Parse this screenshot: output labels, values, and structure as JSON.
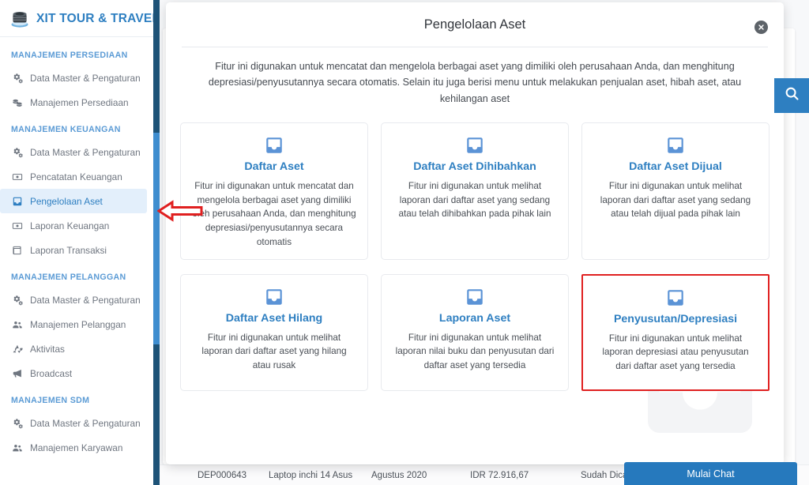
{
  "brand": {
    "name": "XIT TOUR & TRAVEL",
    "logo_icon": "layer-stack-logo",
    "color": "#2e7fc1"
  },
  "sidebar": {
    "groups": [
      {
        "title": "MANAJEMEN PERSEDIAAN",
        "items": [
          {
            "label": "Data Master & Pengaturan",
            "icon": "cogs-icon",
            "active": false
          },
          {
            "label": "Manajemen Persediaan",
            "icon": "coins-icon",
            "active": false
          }
        ]
      },
      {
        "title": "MANAJEMEN KEUANGAN",
        "items": [
          {
            "label": "Data Master & Pengaturan",
            "icon": "cogs-icon",
            "active": false
          },
          {
            "label": "Pencatatan Keuangan",
            "icon": "money-bill-icon",
            "active": false
          },
          {
            "label": "Pengelolaan Aset",
            "icon": "inbox-icon",
            "active": true
          },
          {
            "label": "Laporan Keuangan",
            "icon": "money-bill-icon",
            "active": false
          },
          {
            "label": "Laporan Transaksi",
            "icon": "book-icon",
            "active": false
          }
        ]
      },
      {
        "title": "MANAJEMEN PELANGGAN",
        "items": [
          {
            "label": "Data Master & Pengaturan",
            "icon": "cogs-icon",
            "active": false
          },
          {
            "label": "Manajemen Pelanggan",
            "icon": "users-icon",
            "active": false
          },
          {
            "label": "Aktivitas",
            "icon": "recycle-icon",
            "active": false
          },
          {
            "label": "Broadcast",
            "icon": "bullhorn-icon",
            "active": false
          }
        ]
      },
      {
        "title": "MANAJEMEN SDM",
        "items": [
          {
            "label": "Data Master & Pengaturan",
            "icon": "cogs-icon",
            "active": false
          },
          {
            "label": "Manajemen Karyawan",
            "icon": "users-icon",
            "active": false
          }
        ]
      }
    ]
  },
  "modal": {
    "title": "Pengelolaan Aset",
    "close_icon": "close-circle-icon",
    "description": "Fitur ini digunakan untuk mencatat dan mengelola berbagai aset yang dimiliki oleh perusahaan Anda, dan menghitung depresiasi/penyusutannya secara otomatis. Selain itu juga berisi menu untuk melakukan penjualan aset, hibah aset, atau kehilangan aset",
    "watermark_icon": "inbox-icon",
    "cards": [
      {
        "icon": "inbox-icon",
        "title": "Daftar Aset",
        "description": "Fitur ini digunakan untuk mencatat dan mengelola berbagai aset yang dimiliki oleh perusahaan Anda, dan menghitung depresiasi/penyusutannya secara otomatis",
        "highlighted": false
      },
      {
        "icon": "inbox-icon",
        "title": "Daftar Aset Dihibahkan",
        "description": "Fitur ini digunakan untuk melihat laporan dari daftar aset yang sedang atau telah dihibahkan pada pihak lain",
        "highlighted": false
      },
      {
        "icon": "inbox-icon",
        "title": "Daftar Aset Dijual",
        "description": "Fitur ini digunakan untuk melihat laporan dari daftar aset yang sedang atau telah dijual pada pihak lain",
        "highlighted": false
      },
      {
        "icon": "inbox-icon",
        "title": "Daftar Aset Hilang",
        "description": "Fitur ini digunakan untuk melihat laporan dari daftar aset yang hilang atau rusak",
        "highlighted": false
      },
      {
        "icon": "inbox-icon",
        "title": "Laporan Aset",
        "description": "Fitur ini digunakan untuk melihat laporan nilai buku dan penyusutan dari daftar aset yang tersedia",
        "highlighted": false
      },
      {
        "icon": "inbox-icon",
        "title": "Penyusutan/Depresiasi",
        "description": "Fitur ini digunakan untuk melihat laporan depresiasi atau penyusutan dari daftar aset yang tersedia",
        "highlighted": true
      }
    ]
  },
  "background_table": {
    "row": {
      "code": "DEP000643",
      "item": "Laptop inchi 14 Asus",
      "period": "Agustus 2020",
      "amount": "IDR 72.916,67",
      "status": "Sudah Dicatat P"
    }
  },
  "search_fab": {
    "icon": "search-icon",
    "color": "#2e7fc1"
  },
  "chat_widget": {
    "label": "Mulai Chat",
    "color": "#2679bd"
  },
  "annotations": {
    "arrow_icon": "left-arrow-annotation",
    "arrow_color": "#e02020",
    "highlight_color": "#e02020"
  }
}
